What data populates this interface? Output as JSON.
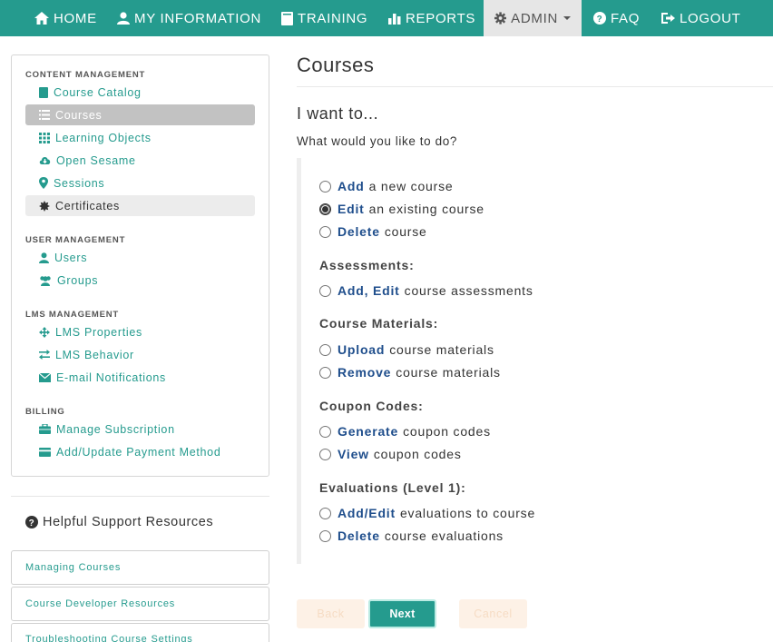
{
  "nav": {
    "home": "HOME",
    "my_information": "MY INFORMATION",
    "training": "TRAINING",
    "reports": "REPORTS",
    "admin": "ADMIN",
    "faq": "FAQ",
    "logout": "LOGOUT"
  },
  "sidebar": {
    "content_management": {
      "title": "CONTENT MANAGEMENT",
      "items": [
        "Course Catalog",
        "Courses",
        "Learning Objects",
        "Open Sesame",
        "Sessions",
        "Certificates"
      ]
    },
    "user_management": {
      "title": "USER MANAGEMENT",
      "items": [
        "Users",
        "Groups"
      ]
    },
    "lms_management": {
      "title": "LMS MANAGEMENT",
      "items": [
        "LMS Properties",
        "LMS Behavior",
        "E-mail Notifications"
      ]
    },
    "billing": {
      "title": "BILLING",
      "items": [
        "Manage Subscription",
        "Add/Update Payment Method"
      ]
    }
  },
  "support": {
    "title": "Helpful Support Resources",
    "links": [
      "Managing Courses",
      "Course Developer Resources",
      "Troubleshooting Course Settings"
    ]
  },
  "main": {
    "title": "Courses",
    "subtitle": "I want to...",
    "question": "What would you like to do?",
    "options": [
      {
        "action": "Add",
        "rest": "a new course",
        "selected": false
      },
      {
        "action": "Edit",
        "rest": "an existing course",
        "selected": true
      },
      {
        "action": "Delete",
        "rest": "course",
        "selected": false
      }
    ],
    "assessments": {
      "title": "Assessments:",
      "options": [
        {
          "action": "Add, Edit",
          "rest": "course assessments"
        }
      ]
    },
    "materials": {
      "title": "Course Materials:",
      "options": [
        {
          "action": "Upload",
          "rest": "course materials"
        },
        {
          "action": "Remove",
          "rest": "course materials"
        }
      ]
    },
    "coupons": {
      "title": "Coupon Codes:",
      "options": [
        {
          "action": "Generate",
          "rest": "coupon codes"
        },
        {
          "action": "View",
          "rest": "coupon codes"
        }
      ]
    },
    "evaluations": {
      "title": "Evaluations (Level 1):",
      "options": [
        {
          "action": "Add/Edit",
          "rest": "evaluations to course"
        },
        {
          "action": "Delete",
          "rest": "course evaluations"
        }
      ]
    }
  },
  "buttons": {
    "back": "Back",
    "next": "Next",
    "cancel": "Cancel"
  },
  "colors": {
    "brand": "#259b8e",
    "action_link": "#1f4e8c",
    "active_nav": "#e6e6e6"
  }
}
